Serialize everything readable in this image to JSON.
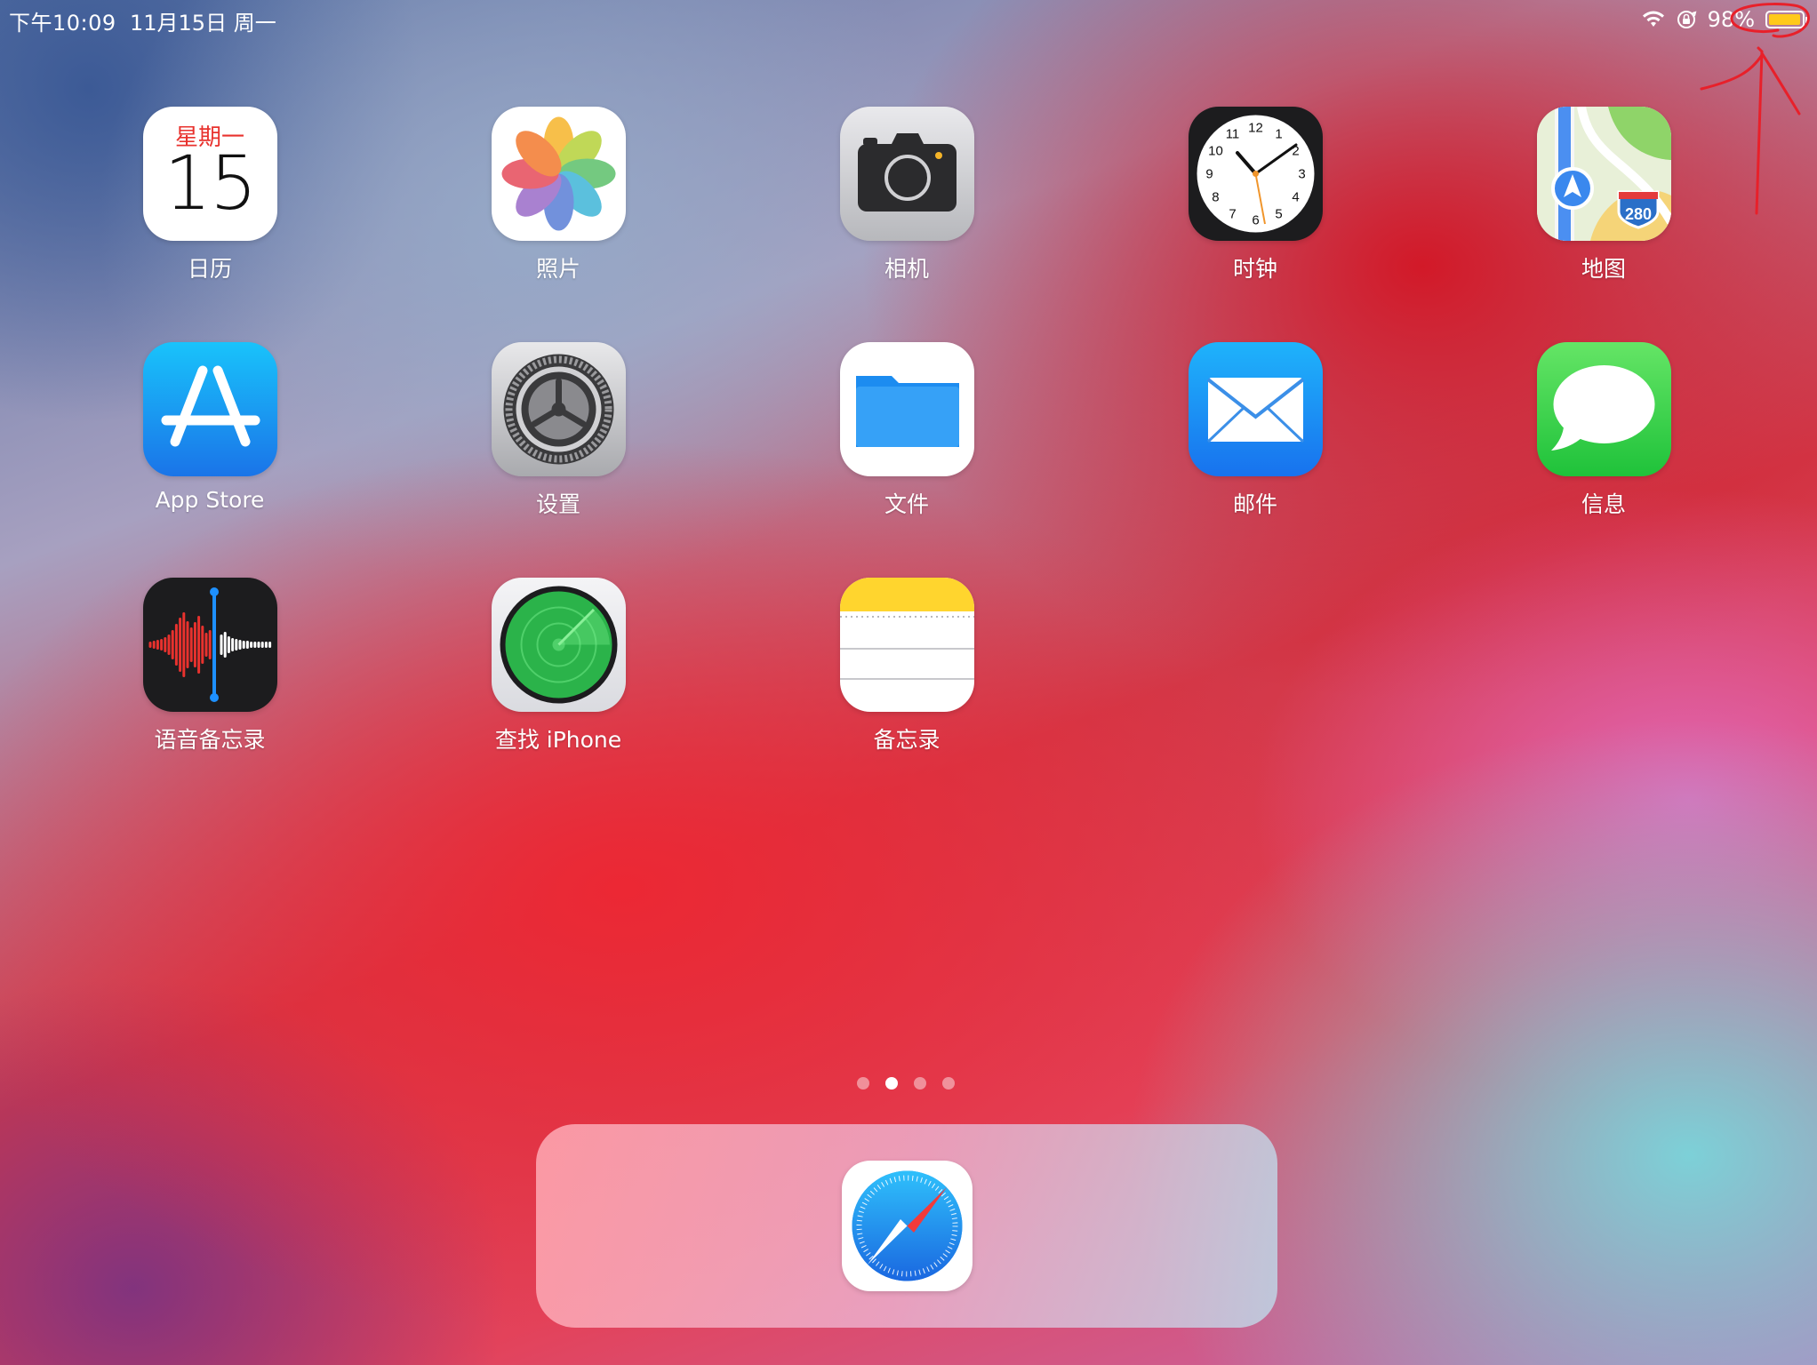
{
  "status_bar": {
    "time": "下午10:09",
    "date": "11月15日 周一",
    "battery_percent": "98%",
    "battery_level": 0.98,
    "icons": [
      "wifi-icon",
      "rotation-lock-icon",
      "battery-icon"
    ]
  },
  "apps": [
    {
      "label": "日历",
      "icon": "calendar-icon",
      "weekday": "星期一",
      "day": "15"
    },
    {
      "label": "照片",
      "icon": "photos-icon"
    },
    {
      "label": "相机",
      "icon": "camera-icon"
    },
    {
      "label": "时钟",
      "icon": "clock-icon",
      "numbers": [
        "12",
        "1",
        "2",
        "3",
        "4",
        "5",
        "6",
        "7",
        "8",
        "9",
        "10",
        "11"
      ]
    },
    {
      "label": "地图",
      "icon": "maps-icon",
      "route_sign": "280"
    },
    {
      "label": "App Store",
      "icon": "app-store-icon"
    },
    {
      "label": "设置",
      "icon": "settings-icon"
    },
    {
      "label": "文件",
      "icon": "files-icon"
    },
    {
      "label": "邮件",
      "icon": "mail-icon"
    },
    {
      "label": "信息",
      "icon": "messages-icon"
    },
    {
      "label": "语音备忘录",
      "icon": "voice-memos-icon"
    },
    {
      "label": "查找 iPhone",
      "icon": "find-iphone-icon"
    },
    {
      "label": "备忘录",
      "icon": "notes-icon"
    }
  ],
  "page_indicator": {
    "count": 4,
    "current": 2
  },
  "dock": [
    {
      "label": "Safari",
      "icon": "safari-icon"
    }
  ],
  "colors": {
    "battery_fill": "#ffc91a",
    "annotation": "#e8202a",
    "calendar_red": "#e8322e"
  }
}
